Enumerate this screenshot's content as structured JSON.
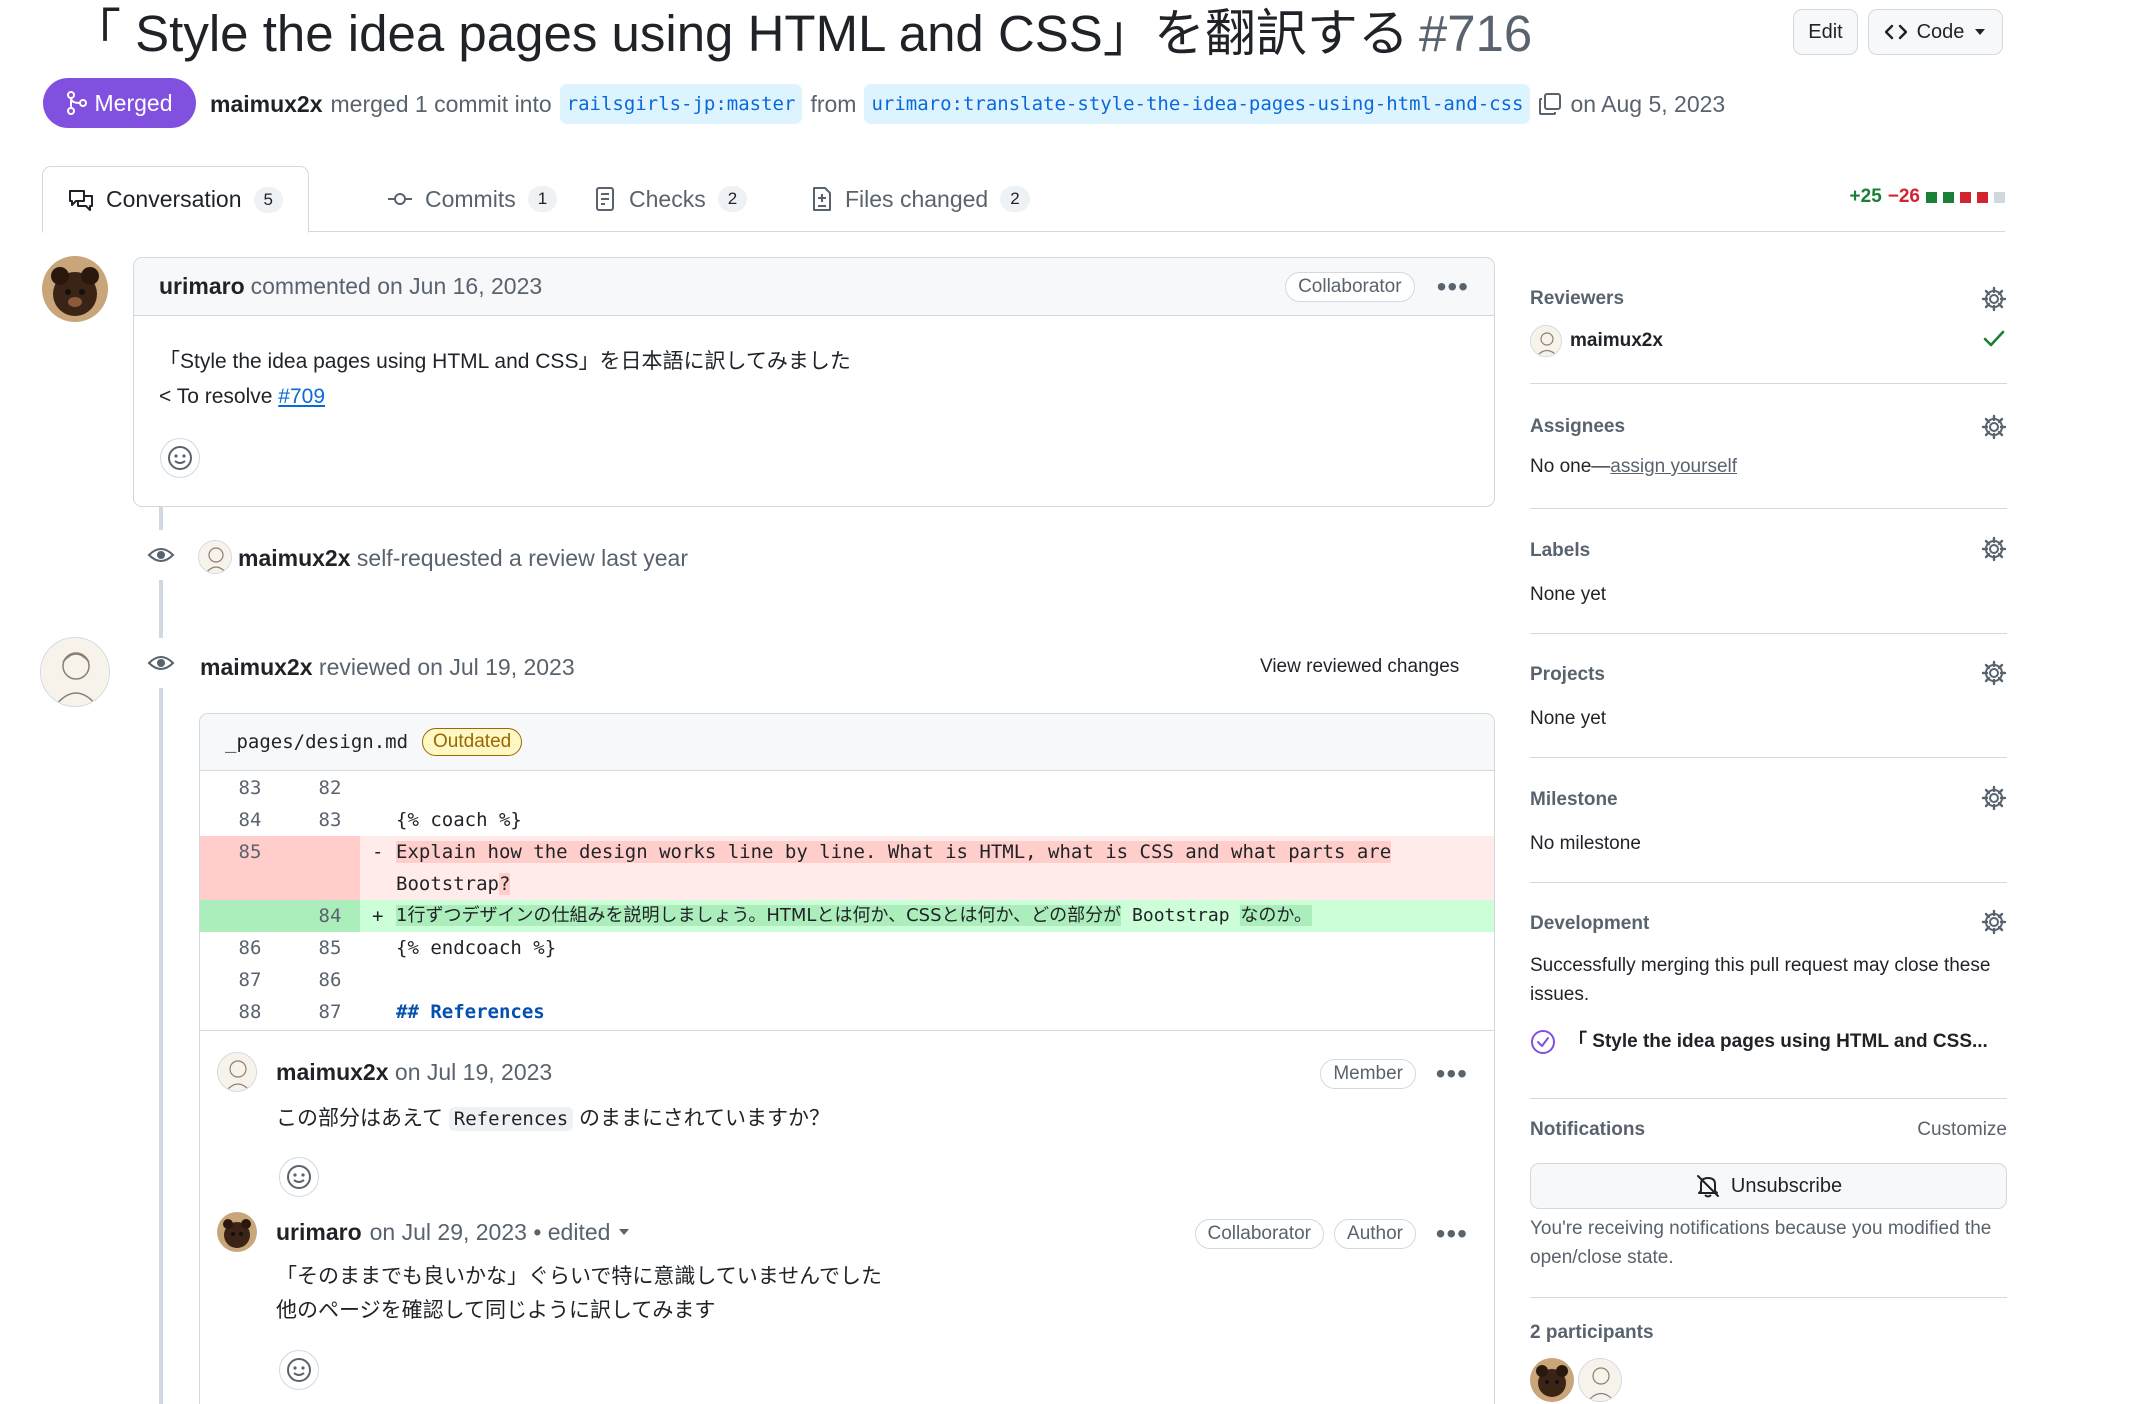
{
  "header": {
    "title": "「 Style the idea pages using HTML and CSS」を翻訳する",
    "number": "#716",
    "edit_label": "Edit",
    "code_label": "Code"
  },
  "status": {
    "badge": "Merged",
    "author": "maimux2x",
    "merged_text": "merged 1 commit into",
    "base_branch": "railsgirls-jp:master",
    "from_text": "from",
    "head_branch": "urimaro:translate-style-the-idea-pages-using-html-and-css",
    "date_text": "on Aug 5, 2023"
  },
  "tabs": [
    {
      "label": "Conversation",
      "count": "5"
    },
    {
      "label": "Commits",
      "count": "1"
    },
    {
      "label": "Checks",
      "count": "2"
    },
    {
      "label": "Files changed",
      "count": "2"
    }
  ],
  "diffstat": {
    "additions": "+25",
    "deletions": "−26"
  },
  "first_comment": {
    "author": "urimaro",
    "meta": "commented on Jun 16, 2023",
    "role": "Collaborator",
    "line1": "「Style the idea pages using HTML and CSS」を日本語に訳してみました",
    "resolve_prefix": "< To resolve",
    "resolve_link": "#709"
  },
  "review_request": {
    "author": "maimux2x",
    "text": "self-requested a review last year"
  },
  "review": {
    "author": "maimux2x",
    "meta": "reviewed on Jul 19, 2023",
    "view_changes": "View reviewed changes"
  },
  "diff": {
    "file": "_pages/design.md",
    "outdated": "Outdated",
    "rows": [
      {
        "old": "83",
        "new": "82",
        "code": ""
      },
      {
        "old": "84",
        "new": "83",
        "code": "{% coach %}"
      },
      {
        "old": "85",
        "new": "",
        "sign": "-",
        "code1": "Explain how the design works line by line. What is HTML, what is CSS and what parts are",
        "code2": "Bootstrap",
        "code2_hl": "?"
      },
      {
        "old": "",
        "new": "84",
        "sign": "+",
        "code_a": "1行ずつデザインの仕組みを説明しましょう。HTMLとは何か、CSSとは何か、どの部分が",
        "code_b": "Bootstrap",
        "code_c": "なのか。"
      },
      {
        "old": "86",
        "new": "85",
        "code": "{% endcoach %}"
      },
      {
        "old": "87",
        "new": "86",
        "code": ""
      },
      {
        "old": "88",
        "new": "87",
        "code": "## References"
      }
    ]
  },
  "thread": [
    {
      "author": "maimux2x",
      "meta": "on Jul 19, 2023",
      "roles": [
        "Member"
      ],
      "body_a": "この部分はあえて",
      "body_code": "References",
      "body_b": "のままにされていますか？"
    },
    {
      "author": "urimaro",
      "meta": "on Jul 29, 2023 • edited",
      "roles": [
        "Collaborator",
        "Author"
      ],
      "line1": "「そのままでも良いかな」ぐらいで特に意識していませんでした",
      "line2": "他のページを確認して同じように訳してみます"
    }
  ],
  "sidebar": {
    "reviewers": {
      "title": "Reviewers",
      "name": "maimux2x"
    },
    "assignees": {
      "title": "Assignees",
      "prefix": "No one—",
      "link": "assign yourself"
    },
    "labels": {
      "title": "Labels",
      "value": "None yet"
    },
    "projects": {
      "title": "Projects",
      "value": "None yet"
    },
    "milestone": {
      "title": "Milestone",
      "value": "No milestone"
    },
    "development": {
      "title": "Development",
      "text": "Successfully merging this pull request may close these issues.",
      "issue": "「 Style the idea pages using HTML and CSS..."
    },
    "notifications": {
      "title": "Notifications",
      "customize": "Customize",
      "button": "Unsubscribe",
      "reason": "You're receiving notifications because you modified the open/close state."
    },
    "participants": {
      "title": "2 participants"
    }
  },
  "colors": {
    "merged": "#8250df",
    "link": "#0969da",
    "add": "#1a7f37",
    "del": "#d1242f"
  }
}
